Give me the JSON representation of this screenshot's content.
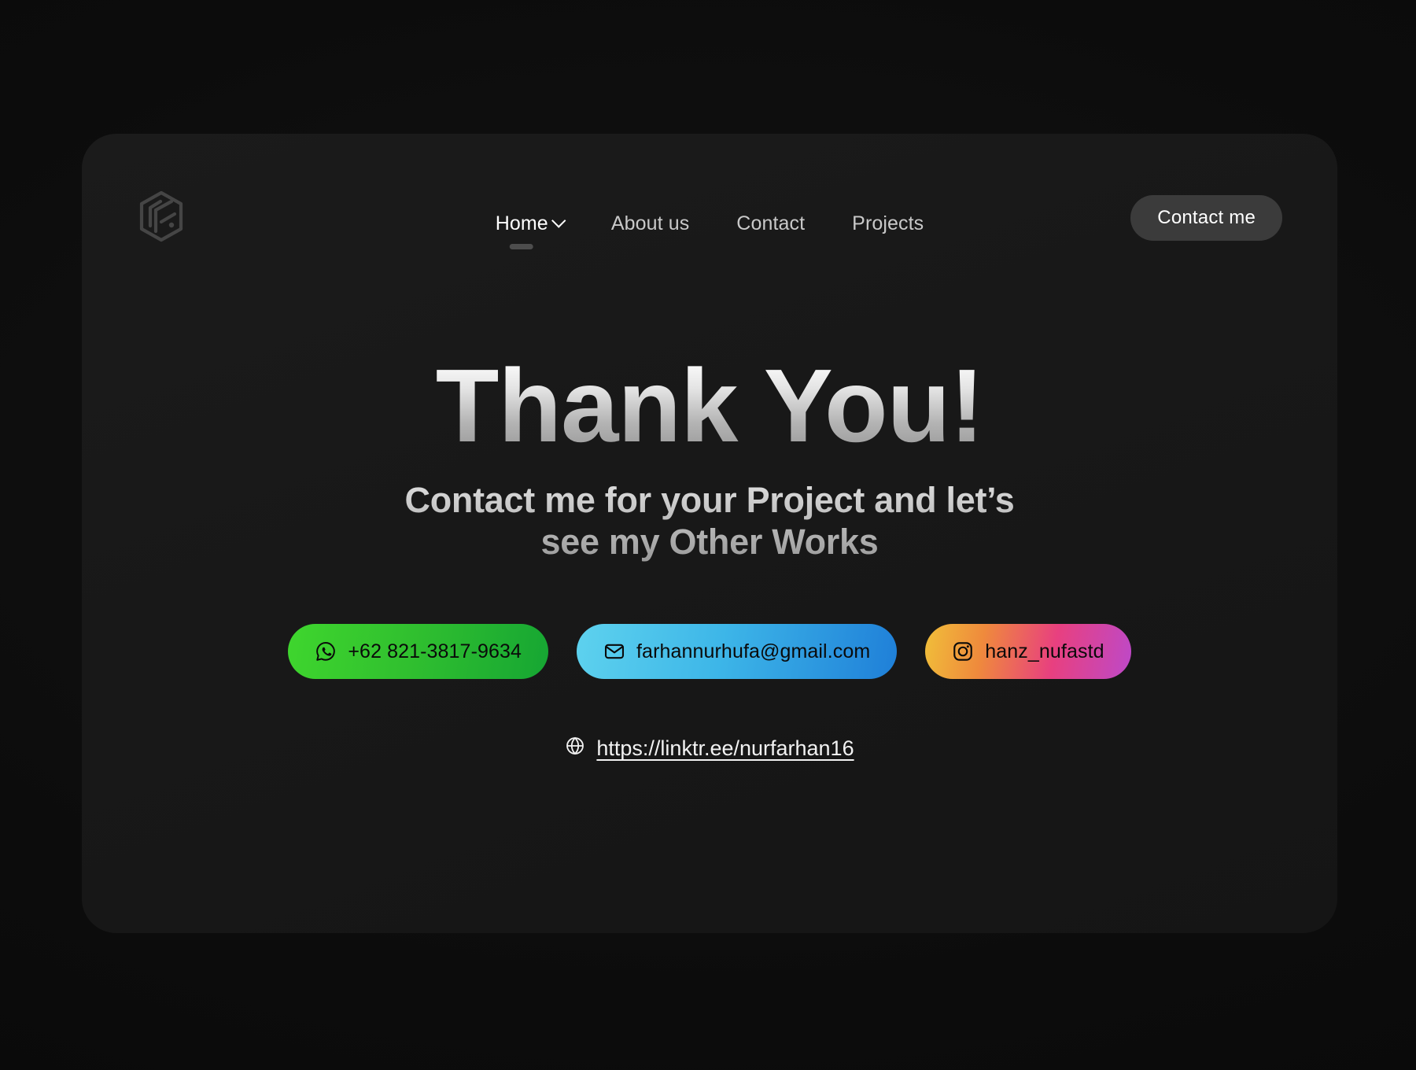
{
  "header": {
    "logo_alt": "NF monogram logo",
    "nav_items": [
      {
        "label": "Home",
        "has_chevron": true,
        "active": true
      },
      {
        "label": "About us",
        "has_chevron": false,
        "active": false
      },
      {
        "label": "Contact",
        "has_chevron": false,
        "active": false
      },
      {
        "label": "Projects",
        "has_chevron": false,
        "active": false
      }
    ],
    "cta_label": "Contact me"
  },
  "hero": {
    "headline": "Thank You!",
    "subhead_line1": "Contact me for your Project and let’s",
    "subhead_line2": "see my Other Works"
  },
  "contacts": [
    {
      "kind": "whatsapp",
      "icon": "whatsapp-icon",
      "label": "+62 821-3817-9634",
      "gradient_from": "#3fd62e",
      "gradient_to": "#16a633"
    },
    {
      "kind": "email",
      "icon": "envelope-icon",
      "label": "farhannurhufa@gmail.com",
      "gradient_from": "#5ed2ee",
      "gradient_to": "#1f7fd8"
    },
    {
      "kind": "instagram",
      "icon": "instagram-icon",
      "label": "hanz_nufastd",
      "gradient_from": "#f0bf3a",
      "gradient_to": "#bd49c9"
    }
  ],
  "weblink": {
    "icon": "globe-icon",
    "url": "https://linktr.ee/nurfarhan16"
  },
  "colors": {
    "page_background": "#0b0b0b",
    "card_background": "#1a1a1a",
    "cta_background": "#3b3b3b",
    "text_primary": "#ffffff",
    "text_muted": "#c9c9c9",
    "pill_text": "#0a0a0a",
    "nav_indicator": "#4d4d4d",
    "logo": "#454545"
  }
}
